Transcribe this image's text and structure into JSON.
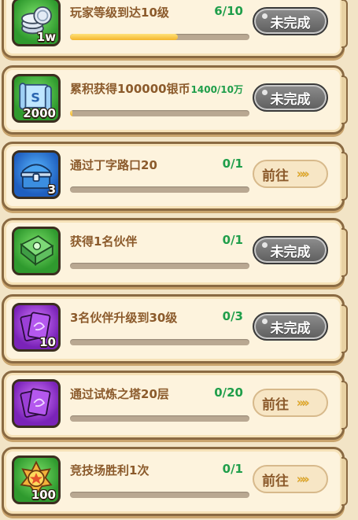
{
  "tasks": [
    {
      "title": "玩家等级到达10级",
      "progress_text": "6/10",
      "progress": 0.6,
      "button": "未完成",
      "button_type": "grey",
      "icon": "silver-coins-icon",
      "icon_color": "green",
      "icon_count": "1w"
    },
    {
      "title": "累积获得100000银币",
      "progress_text": "1400/10万",
      "progress": 0.014,
      "button": "未完成",
      "button_type": "grey",
      "icon": "scroll-icon",
      "icon_color": "green",
      "icon_count": "2000"
    },
    {
      "title": "通过丁字路口20",
      "progress_text": "0/1",
      "progress": 0,
      "button": "前往",
      "button_type": "go",
      "icon": "treasure-chest-icon",
      "icon_color": "blue",
      "icon_count": "3"
    },
    {
      "title": "获得1名伙伴",
      "progress_text": "0/1",
      "progress": 0,
      "button": "未完成",
      "button_type": "grey",
      "icon": "green-book-icon",
      "icon_color": "green",
      "icon_count": ""
    },
    {
      "title": "3名伙伴升级到30级",
      "progress_text": "0/3",
      "progress": 0,
      "button": "未完成",
      "button_type": "grey",
      "icon": "purple-card-icon",
      "icon_color": "purple",
      "icon_count": "10"
    },
    {
      "title": "通过试炼之塔20层",
      "progress_text": "0/20",
      "progress": 0,
      "button": "前往",
      "button_type": "go",
      "icon": "purple-card-icon",
      "icon_color": "purple",
      "icon_count": ""
    },
    {
      "title": "竞技场胜利1次",
      "progress_text": "0/1",
      "progress": 0,
      "button": "前往",
      "button_type": "go",
      "icon": "medal-icon",
      "icon_color": "gold",
      "icon_count": "100"
    }
  ],
  "go_arrows": "»»"
}
